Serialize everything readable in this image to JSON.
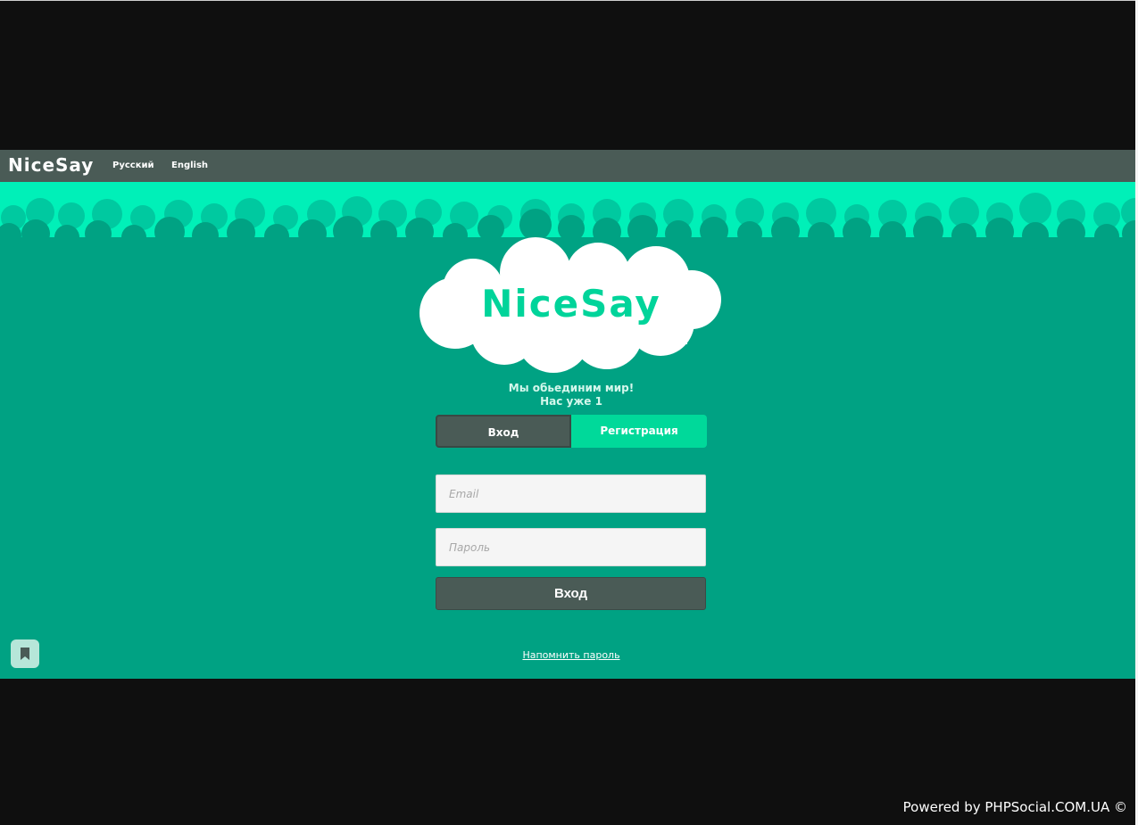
{
  "header": {
    "brand": "NiceSay",
    "languages": [
      "Русский",
      "English"
    ]
  },
  "hero": {
    "logo_text": "NiceSay",
    "tagline_line1": "Мы обьединим мир!",
    "tagline_line2": "Нас уже 1"
  },
  "tabs": {
    "login_label": "Вход",
    "register_label": "Регистрация",
    "active": "login"
  },
  "form": {
    "email_placeholder": "Email",
    "password_placeholder": "Пароль",
    "submit_label": "Вход",
    "remind_link": "Напомнить пароль"
  },
  "footer": {
    "powered_by": "Powered by PHPSocial.COM.UA ©"
  },
  "colors": {
    "topbar": "#4a5b56",
    "hero_bg": "#00a283",
    "hero_sky": "#00f0b8",
    "accent": "#00d99a",
    "logo_text": "#00d49a"
  },
  "icons": {
    "bookmark": "bookmark-icon"
  }
}
